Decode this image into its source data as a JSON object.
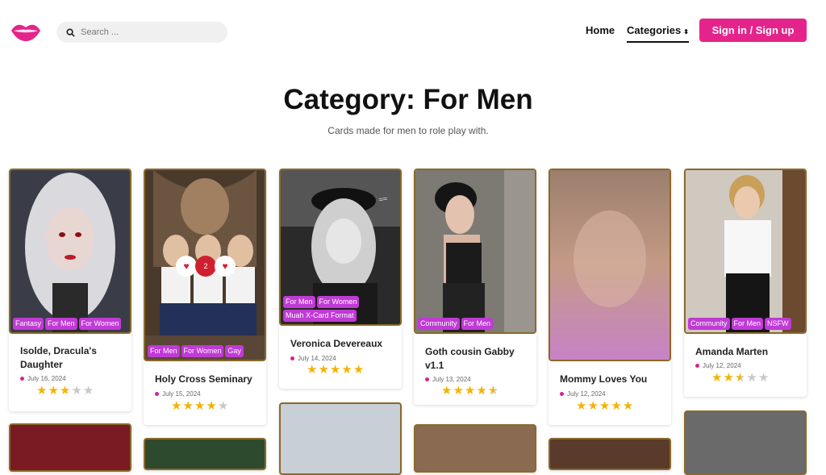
{
  "header": {
    "search_placeholder": "Search ...",
    "nav_home": "Home",
    "nav_categories": "Categories",
    "signin_label": "Sign in / Sign up"
  },
  "page": {
    "title": "Category: For Men",
    "subtitle": "Cards made for men to role play with."
  },
  "colors": {
    "accent": "#e5248b",
    "tag": "#c03ad6",
    "star": "#f5b301",
    "card_border": "#8a6a2a"
  },
  "cards": [
    {
      "name": "Isolde, Dracula's Daughter",
      "date": "July 16, 2024",
      "tags": [
        "Fantasy",
        "For Men",
        "For Women"
      ],
      "rating": 3
    },
    {
      "name": "Holy Cross Seminary",
      "date": "July 15, 2024",
      "tags": [
        "For Men",
        "For Women",
        "Gay"
      ],
      "rating": 4,
      "likes": "2"
    },
    {
      "name": "Veronica Devereaux",
      "date": "July 14, 2024",
      "tags": [
        "For Men",
        "For Women",
        "Muah X-Card Format"
      ],
      "rating": 5
    },
    {
      "name": "Goth cousin Gabby v1.1",
      "date": "July 13, 2024",
      "tags": [
        "Community",
        "For Men"
      ],
      "rating": 4.5
    },
    {
      "name": "Mommy Loves You",
      "date": "July 12, 2024",
      "tags": [],
      "rating": 5
    },
    {
      "name": "Amanda Marten",
      "date": "July 12, 2024",
      "tags": [
        "Community",
        "For Men",
        "NSFW"
      ],
      "rating": 2.5
    }
  ]
}
